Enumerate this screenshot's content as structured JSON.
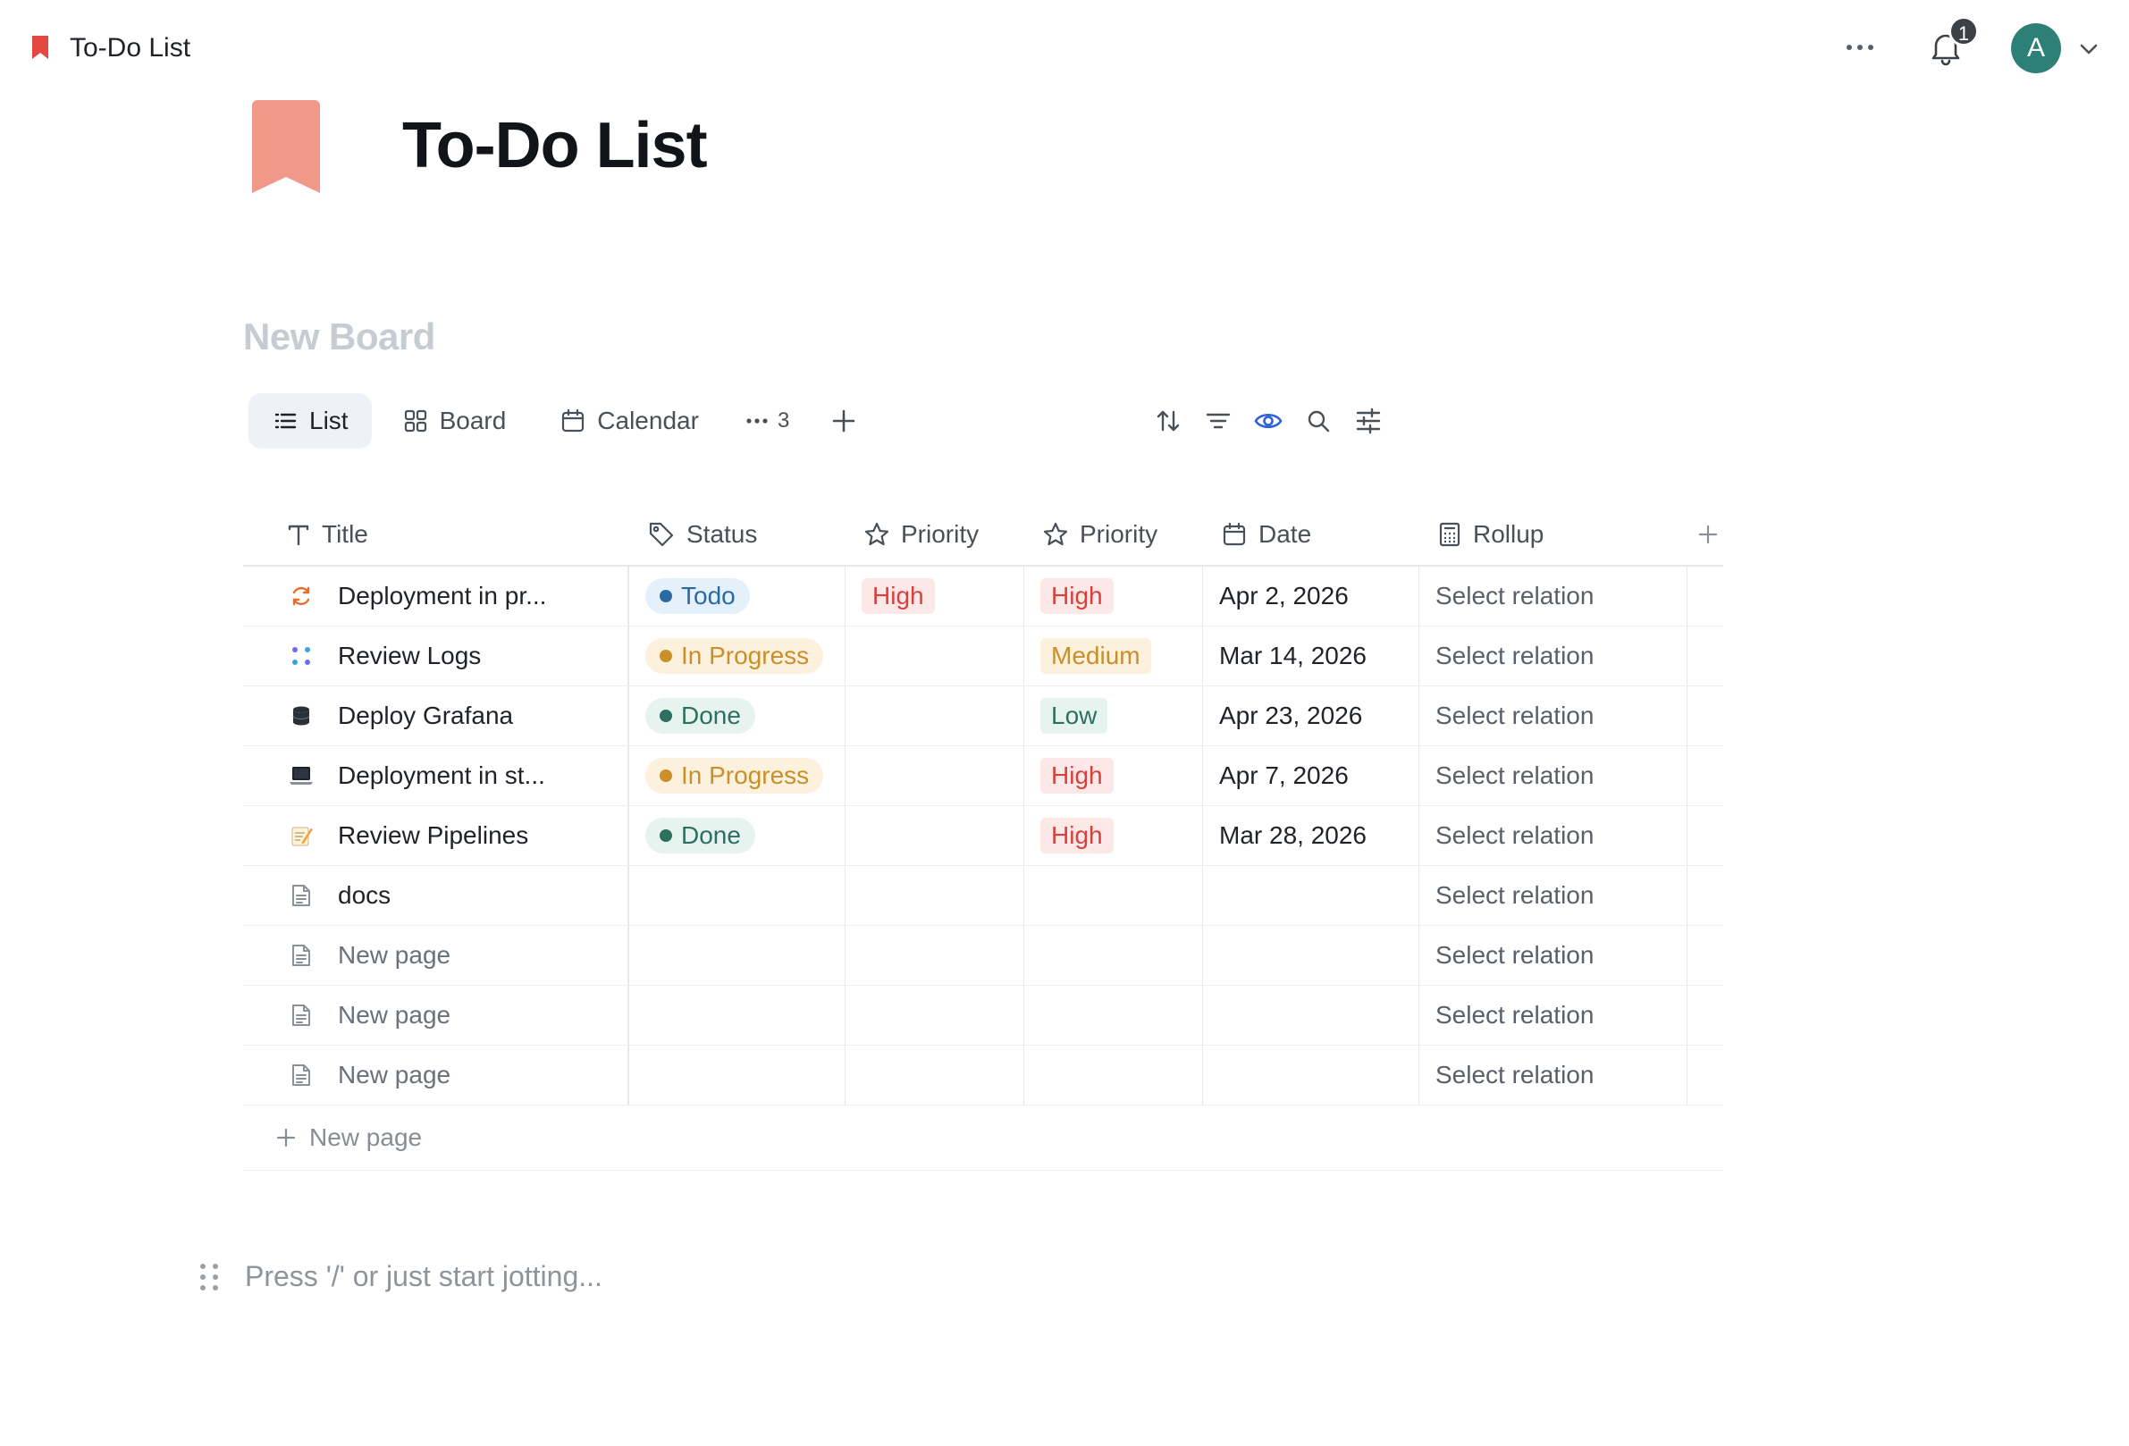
{
  "topbar": {
    "title": "To-Do List",
    "notification_count": "1",
    "avatar_initial": "A",
    "bookmark_color": "#e5483f"
  },
  "page": {
    "title": "To-Do List",
    "icon_color": "#f0998a"
  },
  "board": {
    "name": "New Board",
    "views": [
      {
        "label": "List",
        "icon": "list-icon",
        "active": true
      },
      {
        "label": "Board",
        "icon": "board-grid-icon",
        "active": false
      },
      {
        "label": "Calendar",
        "icon": "calendar-icon",
        "active": false
      }
    ],
    "more_views_count": "3",
    "tools": [
      "sort-icon",
      "filter-icon",
      "eye-icon",
      "search-icon",
      "settings-sliders-icon"
    ]
  },
  "table": {
    "columns": [
      {
        "label": "Title",
        "icon": "text-type-icon"
      },
      {
        "label": "Status",
        "icon": "tag-icon"
      },
      {
        "label": "Priority",
        "icon": "star-icon"
      },
      {
        "label": "Priority",
        "icon": "star-icon"
      },
      {
        "label": "Date",
        "icon": "calendar-icon"
      },
      {
        "label": "Rollup",
        "icon": "calculator-icon"
      }
    ],
    "rows": [
      {
        "title": "Deployment in pr...",
        "icon": "refresh-icon",
        "status": "Todo",
        "priority1": "High",
        "priority2": "High",
        "date": "Apr 2, 2026",
        "rollup": "Select relation"
      },
      {
        "title": "Review Logs",
        "icon": "dots-grid-icon",
        "status": "In Progress",
        "priority1": "",
        "priority2": "Medium",
        "date": "Mar 14, 2026",
        "rollup": "Select relation"
      },
      {
        "title": "Deploy Grafana",
        "icon": "database-icon",
        "status": "Done",
        "priority1": "",
        "priority2": "Low",
        "date": "Apr 23, 2026",
        "rollup": "Select relation"
      },
      {
        "title": "Deployment in st...",
        "icon": "laptop-icon",
        "status": "In Progress",
        "priority1": "",
        "priority2": "High",
        "date": "Apr 7, 2026",
        "rollup": "Select relation"
      },
      {
        "title": "Review Pipelines",
        "icon": "memo-icon",
        "status": "Done",
        "priority1": "",
        "priority2": "High",
        "date": "Mar 28, 2026",
        "rollup": "Select relation"
      },
      {
        "title": "docs",
        "icon": "document-icon",
        "status": "",
        "priority1": "",
        "priority2": "",
        "date": "",
        "rollup": "Select relation"
      },
      {
        "title": "New page",
        "icon": "document-icon",
        "status": "",
        "priority1": "",
        "priority2": "",
        "date": "",
        "rollup": "Select relation"
      },
      {
        "title": "New page",
        "icon": "document-icon",
        "status": "",
        "priority1": "",
        "priority2": "",
        "date": "",
        "rollup": "Select relation"
      },
      {
        "title": "New page",
        "icon": "document-icon",
        "status": "",
        "priority1": "",
        "priority2": "",
        "date": "",
        "rollup": "Select relation"
      }
    ],
    "new_page_label": "New page"
  },
  "status_colors": {
    "Todo": {
      "bg": "#e4f0fa",
      "fg": "#2a6aa3",
      "dot": "#2a6aa3"
    },
    "In Progress": {
      "bg": "#fcf1dc",
      "fg": "#c88f2b",
      "dot": "#c88f2b"
    },
    "Done": {
      "bg": "#e6f3ef",
      "fg": "#2e7060",
      "dot": "#2e7060"
    }
  },
  "priority_colors": {
    "High": {
      "bg": "#fde8e8",
      "fg": "#d6403e"
    },
    "Medium": {
      "bg": "#fcf1dc",
      "fg": "#c88f2b"
    },
    "Low": {
      "bg": "#e6f3ef",
      "fg": "#2e7060"
    }
  },
  "editor": {
    "placeholder": "Press '/' or just start jotting..."
  }
}
